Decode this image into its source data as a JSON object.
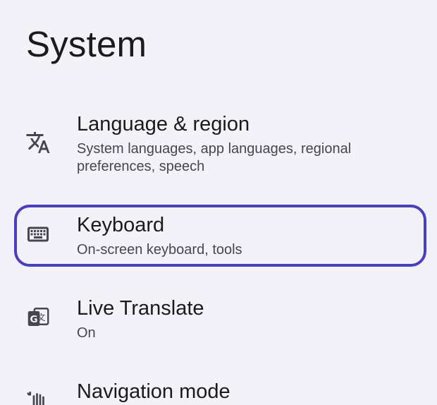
{
  "page": {
    "title": "System"
  },
  "items": [
    {
      "icon": "translate-icon",
      "title": "Language & region",
      "summary": "System languages, app languages, regional preferences, speech"
    },
    {
      "icon": "keyboard-icon",
      "title": "Keyboard",
      "summary": "On-screen keyboard, tools",
      "highlighted": true
    },
    {
      "icon": "live-translate-icon",
      "title": "Live Translate",
      "summary": "On"
    },
    {
      "icon": "gesture-icon",
      "title": "Navigation mode",
      "summary": ""
    }
  ],
  "colors": {
    "background": "#f3f2f8",
    "highlight": "#4a3fc4",
    "primary_text": "#1b1b1f",
    "secondary_text": "#46464f"
  }
}
